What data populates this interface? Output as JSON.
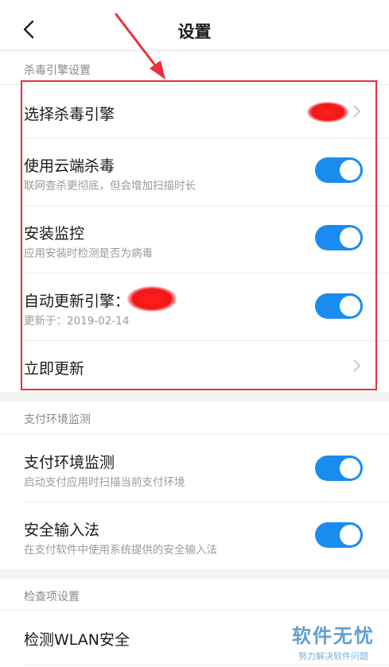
{
  "header": {
    "title": "设置"
  },
  "sections": {
    "engine": {
      "label": "杀毒引擎设置",
      "rows": [
        {
          "title": "选择杀毒引擎"
        },
        {
          "title": "使用云端杀毒",
          "subtitle": "联网查杀更彻底，但会增加扫描时长",
          "enabled": true
        },
        {
          "title": "安装监控",
          "subtitle": "应用安装时检测是否为病毒",
          "enabled": true
        },
        {
          "title": "自动更新引擎：",
          "subtitle": "更新于：2019-02-14",
          "enabled": true
        },
        {
          "title": "立即更新"
        }
      ]
    },
    "payment": {
      "label": "支付环境监测",
      "rows": [
        {
          "title": "支付环境监测",
          "subtitle": "启动支付应用时扫描当前支付环境",
          "enabled": true
        },
        {
          "title": "安全输入法",
          "subtitle": "在支付软件中使用系统提供的安全输入法",
          "enabled": true
        }
      ]
    },
    "checks": {
      "label": "检查项设置",
      "rows": [
        {
          "title": "检测WLAN安全"
        }
      ]
    }
  },
  "watermark": {
    "main": "软件无忧",
    "sub": "努力解决软件问题"
  },
  "colors": {
    "toggle_on": "#1a8cf0",
    "annotation_red": "#e8313a"
  }
}
